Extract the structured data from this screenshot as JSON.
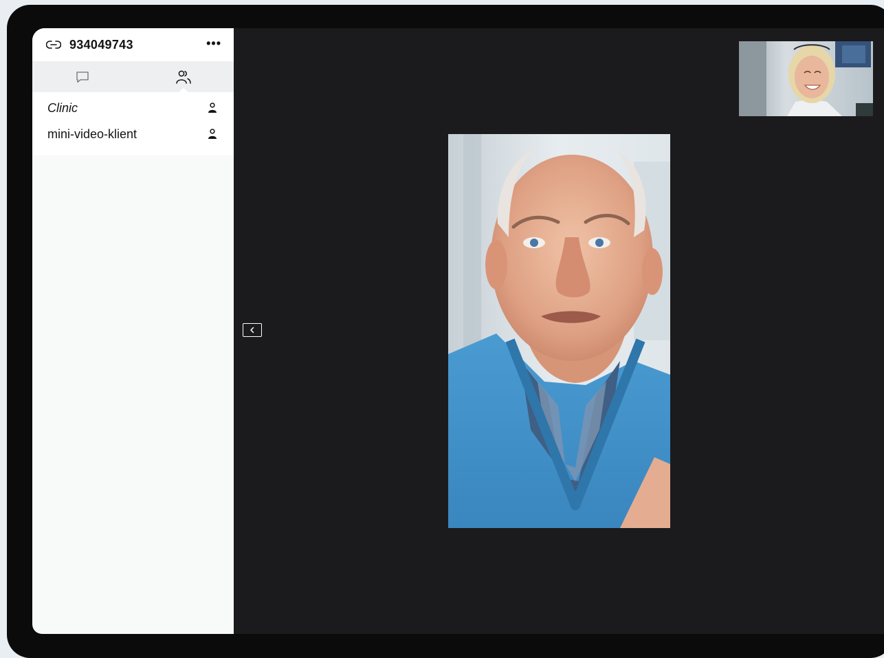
{
  "header": {
    "meeting_id": "934049743",
    "more_label": "•••",
    "link_icon": "link-icon",
    "more_icon": "more-horizontal-icon"
  },
  "tabs": [
    {
      "name": "chat",
      "icon": "chat-bubble-icon",
      "active": false
    },
    {
      "name": "participants",
      "icon": "participants-icon",
      "active": true
    }
  ],
  "participants": [
    {
      "name": "Clinic",
      "italic": true,
      "icon": "person-icon"
    },
    {
      "name": "mini-video-klient",
      "italic": false,
      "icon": "person-icon"
    }
  ],
  "controls": {
    "collapse_icon": "chevron-left-icon"
  },
  "videos": {
    "main": "remote-participant-video",
    "self": "self-view-video"
  },
  "colors": {
    "background": "#1b1b1d",
    "sidebar": "#f8f9f9",
    "sweater_blue": "#3f8fc8",
    "frame": "#0b0b0c"
  }
}
